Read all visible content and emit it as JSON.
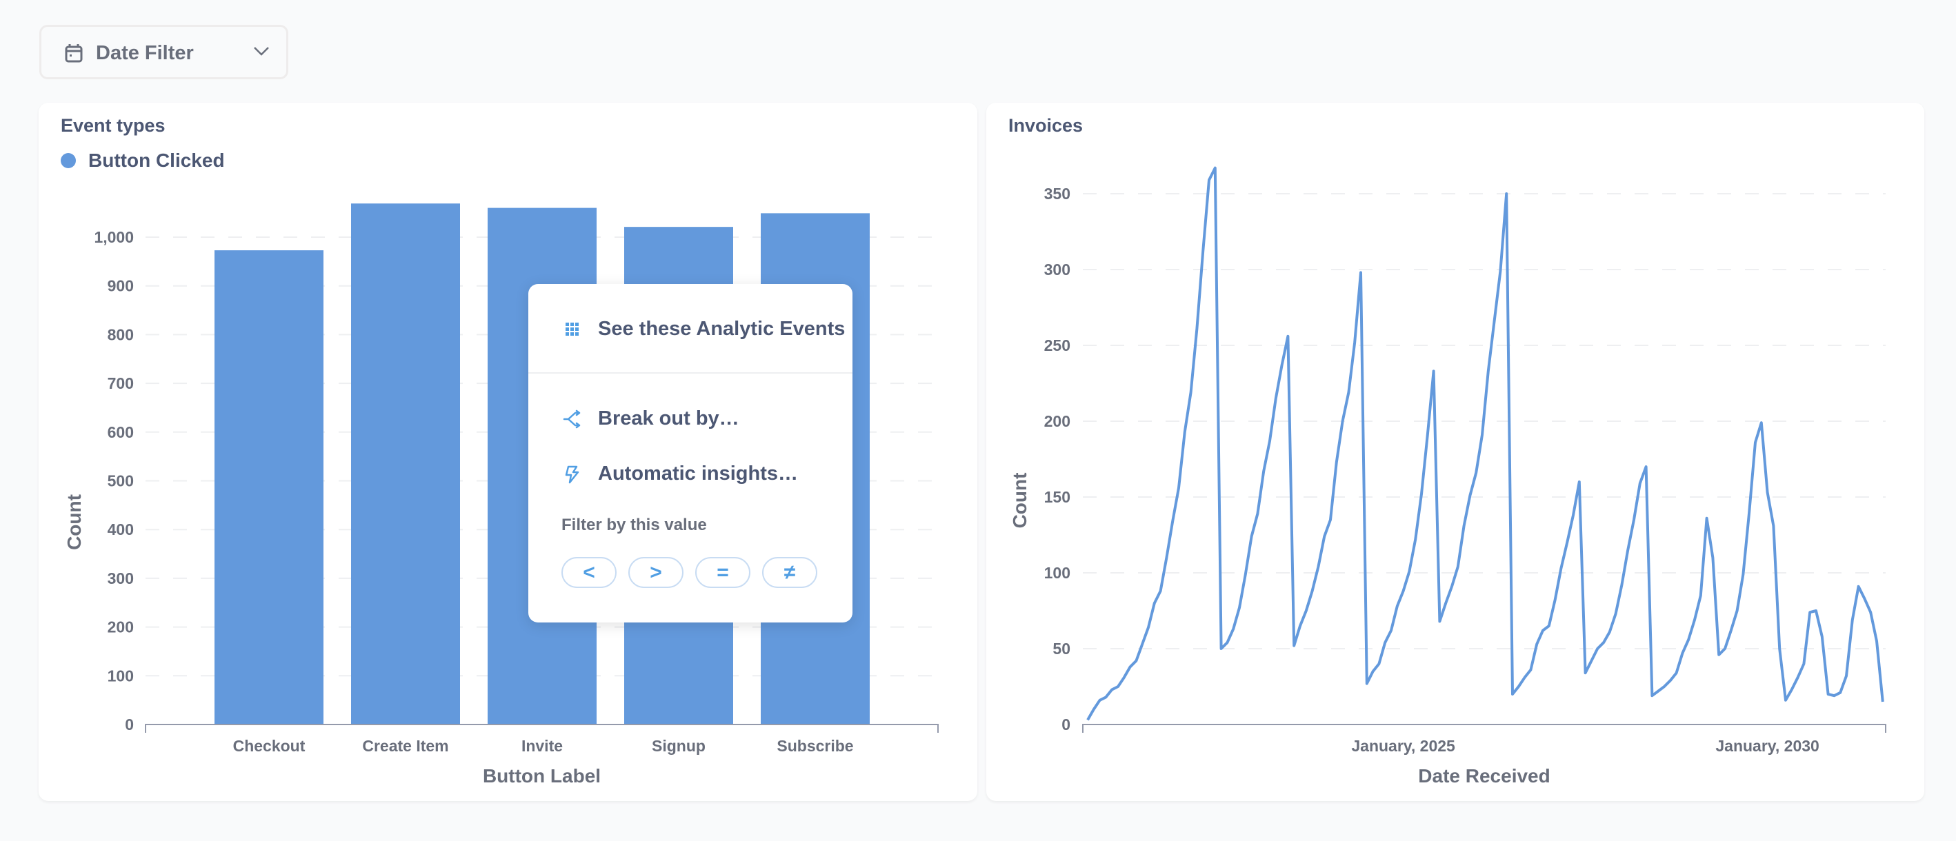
{
  "date_filter": {
    "label": "Date Filter",
    "icon": "calendar-icon",
    "chevron": "chevron-down-icon"
  },
  "cards": {
    "left": {
      "title": "Event types",
      "legend": "Button Clicked"
    },
    "right": {
      "title": "Invoices"
    }
  },
  "colors": {
    "series": "#6399dc",
    "accent": "#509ee3",
    "text": "#4c5773",
    "axis_text": "#696e7b"
  },
  "popup": {
    "items": [
      {
        "label": "See these Analytic Events",
        "icon": "grid-icon"
      },
      {
        "label": "Break out by…",
        "icon": "split-arrows-icon"
      },
      {
        "label": "Automatic insights…",
        "icon": "bolt-icon"
      }
    ],
    "filter_title": "Filter by this value",
    "operators": [
      "<",
      ">",
      "=",
      "≠"
    ]
  },
  "chart_data": [
    {
      "type": "bar",
      "title": "Event types",
      "legend": [
        "Button Clicked"
      ],
      "legend_position": "top-left",
      "categories": [
        "Checkout",
        "Create Item",
        "Invite",
        "Signup",
        "Subscribe"
      ],
      "values": [
        973,
        1069,
        1060,
        1021,
        1049
      ],
      "xlabel": "Button Label",
      "ylabel": "Count",
      "ylim": [
        0,
        1000
      ],
      "yticks": [
        0,
        100,
        200,
        300,
        400,
        500,
        600,
        700,
        800,
        900,
        1000
      ],
      "ytick_labels": [
        "0",
        "100",
        "200",
        "300",
        "400",
        "500",
        "600",
        "700",
        "800",
        "900",
        "1,000"
      ],
      "grid": true
    },
    {
      "type": "line",
      "title": "Invoices",
      "xlabel": "Date Received",
      "ylabel": "Count",
      "x_start": "2020-09",
      "x_interval": "month",
      "xtick_labels": [
        {
          "index": 52,
          "label": "January, 2025"
        },
        {
          "index": 112,
          "label": "January, 2030"
        }
      ],
      "ylim": [
        0,
        350
      ],
      "yticks": [
        0,
        50,
        100,
        150,
        200,
        250,
        300,
        350
      ],
      "grid": true,
      "values": [
        3,
        10,
        16,
        18,
        23,
        25,
        31,
        38,
        42,
        53,
        64,
        80,
        88,
        110,
        134,
        156,
        193,
        219,
        261,
        312,
        359,
        367,
        50,
        54,
        63,
        77,
        99,
        124,
        139,
        167,
        187,
        215,
        237,
        256,
        52,
        65,
        75,
        88,
        104,
        124,
        135,
        173,
        200,
        219,
        252,
        298,
        27,
        35,
        40,
        54,
        62,
        78,
        88,
        101,
        122,
        152,
        191,
        233,
        68,
        80,
        91,
        104,
        131,
        151,
        166,
        191,
        233,
        266,
        299,
        350,
        20,
        25,
        31,
        36,
        53,
        62,
        65,
        82,
        103,
        120,
        138,
        160,
        34,
        42,
        50,
        54,
        61,
        73,
        92,
        115,
        135,
        159,
        170,
        19,
        22,
        25,
        29,
        34,
        47,
        56,
        69,
        85,
        136,
        110,
        46,
        50,
        62,
        75,
        99,
        140,
        186,
        199,
        153,
        131,
        50,
        16,
        23,
        31,
        40,
        74,
        75,
        58,
        20,
        19,
        21,
        32,
        69,
        91,
        83,
        74,
        55,
        15
      ]
    }
  ]
}
